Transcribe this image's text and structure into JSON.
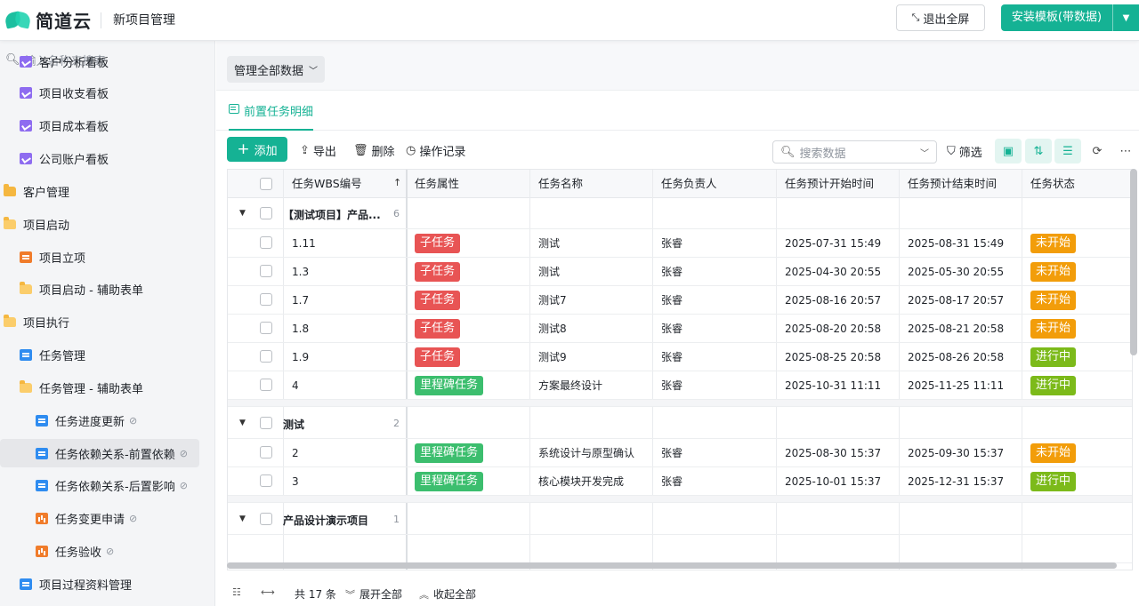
{
  "topbar": {
    "logo_text": "简道云",
    "app_title": "新项目管理",
    "exit_fullscreen": "退出全屏",
    "install_template": "安装模板(带数据)"
  },
  "sidebar": {
    "search_placeholder": "输入名称来搜索",
    "items": [
      {
        "label": "客户分析看板",
        "icon": "chart-icon"
      },
      {
        "label": "项目收支看板",
        "icon": "chart-icon"
      },
      {
        "label": "项目成本看板",
        "icon": "chart-icon"
      },
      {
        "label": "公司账户看板",
        "icon": "chart-icon"
      },
      {
        "label": "客户管理",
        "icon": "folder-icon"
      },
      {
        "label": "项目启动",
        "icon": "folder-icon"
      },
      {
        "label": "项目立项",
        "icon": "form-icon"
      },
      {
        "label": "项目启动 - 辅助表单",
        "icon": "folder-icon"
      },
      {
        "label": "项目执行",
        "icon": "folder-icon"
      },
      {
        "label": "任务管理",
        "icon": "form-icon"
      },
      {
        "label": "任务管理 - 辅助表单",
        "icon": "folder-icon"
      },
      {
        "label": "任务进度更新",
        "icon": "form-icon",
        "hidden": true
      },
      {
        "label": "任务依赖关系-前置依赖",
        "icon": "form-icon",
        "hidden": true,
        "active": true
      },
      {
        "label": "任务依赖关系-后置影响",
        "icon": "form-icon",
        "hidden": true
      },
      {
        "label": "任务变更申请",
        "icon": "bars-icon",
        "hidden": true
      },
      {
        "label": "任务验收",
        "icon": "bars-icon",
        "hidden": true
      },
      {
        "label": "项目过程资料管理",
        "icon": "form-icon"
      }
    ]
  },
  "main": {
    "scope": "管理全部数据",
    "tab": "前置任务明细",
    "toolbar": {
      "add": "添加",
      "export": "导出",
      "delete": "删除",
      "log": "操作记录",
      "search_placeholder": "搜索数据",
      "filter": "筛选"
    },
    "columns": [
      "任务WBS编号",
      "任务属性",
      "任务名称",
      "任务负责人",
      "任务预计开始时间",
      "任务预计结束时间",
      "任务状态"
    ],
    "groups": [
      {
        "name": "【测试项目】产品...",
        "count": "6",
        "rows": [
          {
            "wbs": "1.11",
            "attr": "子任务",
            "attr_color": "red",
            "name": "测试",
            "owner": "张睿",
            "start": "2025-07-31 15:49",
            "end": "2025-08-31 15:49",
            "status": "未开始",
            "status_color": "orange"
          },
          {
            "wbs": "1.3",
            "attr": "子任务",
            "attr_color": "red",
            "name": "测试",
            "owner": "张睿",
            "start": "2025-04-30 20:55",
            "end": "2025-05-30 20:55",
            "status": "未开始",
            "status_color": "orange"
          },
          {
            "wbs": "1.7",
            "attr": "子任务",
            "attr_color": "red",
            "name": "测试7",
            "owner": "张睿",
            "start": "2025-08-16 20:57",
            "end": "2025-08-17 20:57",
            "status": "未开始",
            "status_color": "orange"
          },
          {
            "wbs": "1.8",
            "attr": "子任务",
            "attr_color": "red",
            "name": "测试8",
            "owner": "张睿",
            "start": "2025-08-20 20:58",
            "end": "2025-08-21 20:58",
            "status": "未开始",
            "status_color": "orange"
          },
          {
            "wbs": "1.9",
            "attr": "子任务",
            "attr_color": "red",
            "name": "测试9",
            "owner": "张睿",
            "start": "2025-08-25 20:58",
            "end": "2025-08-26 20:58",
            "status": "进行中",
            "status_color": "lime"
          },
          {
            "wbs": "4",
            "attr": "里程碑任务",
            "attr_color": "green",
            "name": "方案最终设计",
            "owner": "张睿",
            "start": "2025-10-31 11:11",
            "end": "2025-11-25 11:11",
            "status": "进行中",
            "status_color": "lime"
          }
        ]
      },
      {
        "name": "测试",
        "count": "2",
        "rows": [
          {
            "wbs": "2",
            "attr": "里程碑任务",
            "attr_color": "green",
            "name": "系统设计与原型确认",
            "owner": "张睿",
            "start": "2025-08-30 15:37",
            "end": "2025-09-30 15:37",
            "status": "未开始",
            "status_color": "orange"
          },
          {
            "wbs": "3",
            "attr": "里程碑任务",
            "attr_color": "green",
            "name": "核心模块开发完成",
            "owner": "张睿",
            "start": "2025-10-01 15:37",
            "end": "2025-12-31 15:37",
            "status": "进行中",
            "status_color": "lime"
          }
        ]
      },
      {
        "name": "产品设计演示项目",
        "count": "1",
        "rows": []
      }
    ],
    "footer": {
      "total": "共 17 条",
      "expand_all": "展开全部",
      "collapse_all": "收起全部"
    }
  }
}
